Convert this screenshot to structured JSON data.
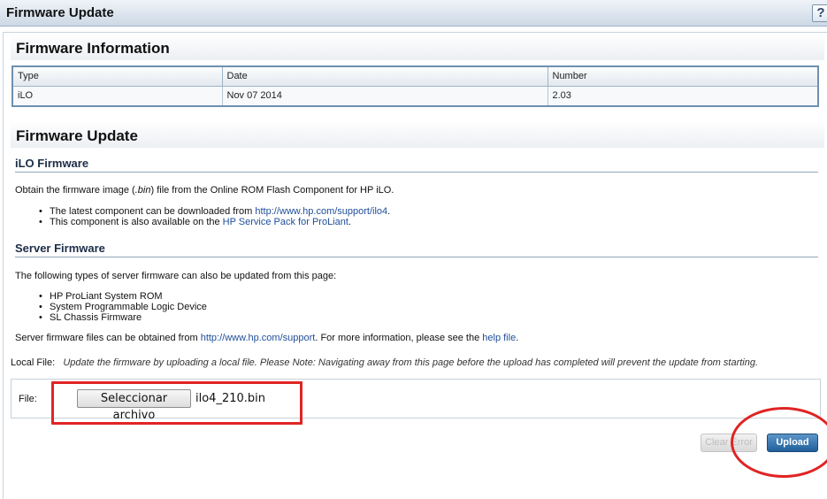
{
  "window": {
    "title": "Firmware Update",
    "help_label": "?"
  },
  "firmware_info": {
    "heading": "Firmware Information",
    "columns": [
      "Type",
      "Date",
      "Number"
    ],
    "rows": [
      [
        "iLO",
        "Nov 07 2014",
        "2.03"
      ]
    ]
  },
  "firmware_update": {
    "heading": "Firmware Update",
    "ilo": {
      "heading": "iLO Firmware",
      "intro_1": "Obtain the firmware image (",
      "intro_ext": ".bin",
      "intro_2": ") file from the Online ROM Flash Component for HP iLO.",
      "bullet_1_text": "The latest component can be downloaded from ",
      "bullet_1_link": "http://www.hp.com/support/ilo4",
      "bullet_1_end": ".",
      "bullet_2_text": "This component is also available on the ",
      "bullet_2_link": "HP Service Pack for ProLiant",
      "bullet_2_end": "."
    },
    "server": {
      "heading": "Server Firmware",
      "intro": "The following types of server firmware can also be updated from this page:",
      "items": [
        "HP ProLiant System ROM",
        "System Programmable Logic Device",
        "SL Chassis Firmware"
      ],
      "files_text_1": "Server firmware files can be obtained from ",
      "files_link": "http://www.hp.com/support",
      "files_text_2": ". For more information, please see the ",
      "help_link": "help file",
      "files_text_3": "."
    },
    "local_file": {
      "label": "Local File:",
      "description": "Update the firmware by uploading a local file.  Please Note:  Navigating away from this page before the upload has completed will prevent the update from starting."
    },
    "file_input": {
      "label": "File:",
      "button_label": "Seleccionar archivo",
      "chosen_file": "ilo4_210.bin"
    },
    "actions": {
      "clear_error_label": "Clear Error",
      "upload_label": "Upload"
    }
  },
  "annotation_color": "#e02424"
}
